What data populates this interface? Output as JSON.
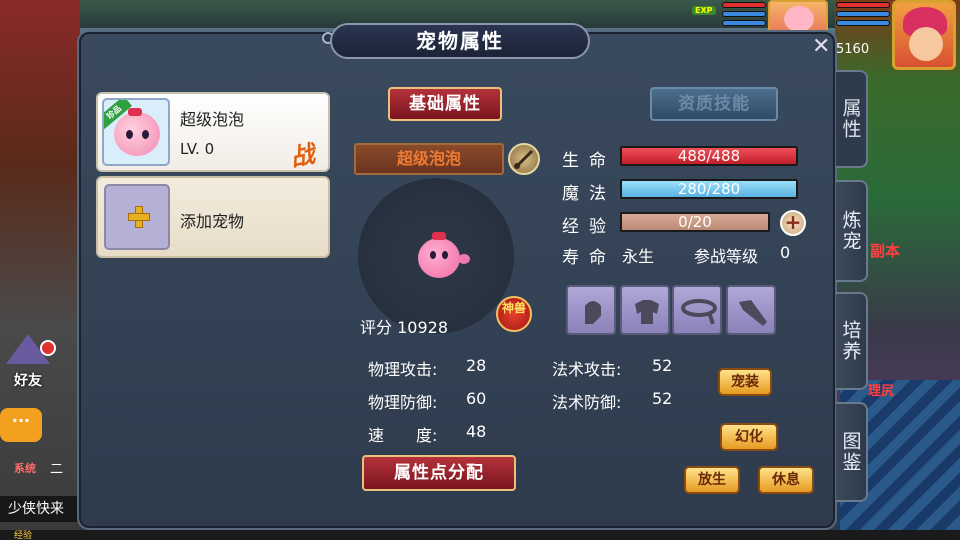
{
  "hud": {
    "exp_tag": "EXP",
    "gold": "5160"
  },
  "dialog": {
    "title": "宠物属性",
    "close": "✕"
  },
  "tabs": [
    "属性",
    "炼宠",
    "培养",
    "图鉴"
  ],
  "pet_list": {
    "pet": {
      "ribbon": "珍品",
      "name": "超级泡泡",
      "level": "LV. 0",
      "battle_mark": "战"
    },
    "add_label": "添加宠物"
  },
  "top_tabs": {
    "basic": "基础属性",
    "talent": "资质技能"
  },
  "pet_name": "超级泡泡",
  "score": {
    "label": "评分",
    "value": "10928"
  },
  "shen_badge": "神兽",
  "stats": {
    "hp": {
      "label": "生命",
      "value": "488/488",
      "fraction": 1.0
    },
    "mp": {
      "label": "魔法",
      "value": "280/280",
      "fraction": 1.0
    },
    "exp": {
      "label": "经验",
      "value": "0/20",
      "fraction": 0.0
    },
    "life": {
      "label": "寿命",
      "value": "永生"
    },
    "combat_level": {
      "label": "参战等级",
      "value": "0"
    }
  },
  "attributes": {
    "phys_atk": {
      "label": "物理攻击:",
      "value": "28"
    },
    "phys_def": {
      "label": "物理防御:",
      "value": "60"
    },
    "speed": {
      "label": "速　　度:",
      "value": "48"
    },
    "mag_atk": {
      "label": "法术攻击:",
      "value": "52"
    },
    "mag_def": {
      "label": "法术防御:",
      "value": "52"
    }
  },
  "buttons": {
    "allocate": "属性点分配",
    "equip": "宠装",
    "transform": "幻化",
    "release": "放生",
    "rest": "休息"
  },
  "left_hud": {
    "friend": "好友",
    "chat_icon": "···",
    "system_tag": "系统",
    "system_text": "二",
    "chat_line": "少侠快来"
  },
  "map_labels": {
    "dungeon": "副本",
    "place": "理尻"
  },
  "bottom": {
    "exp": "经验"
  },
  "colors": {
    "hp_bar": "#e0303a",
    "mp_bar": "#7ad0f0",
    "exp_bar": "#c99a86",
    "accent_gold": "#e6c27a"
  }
}
